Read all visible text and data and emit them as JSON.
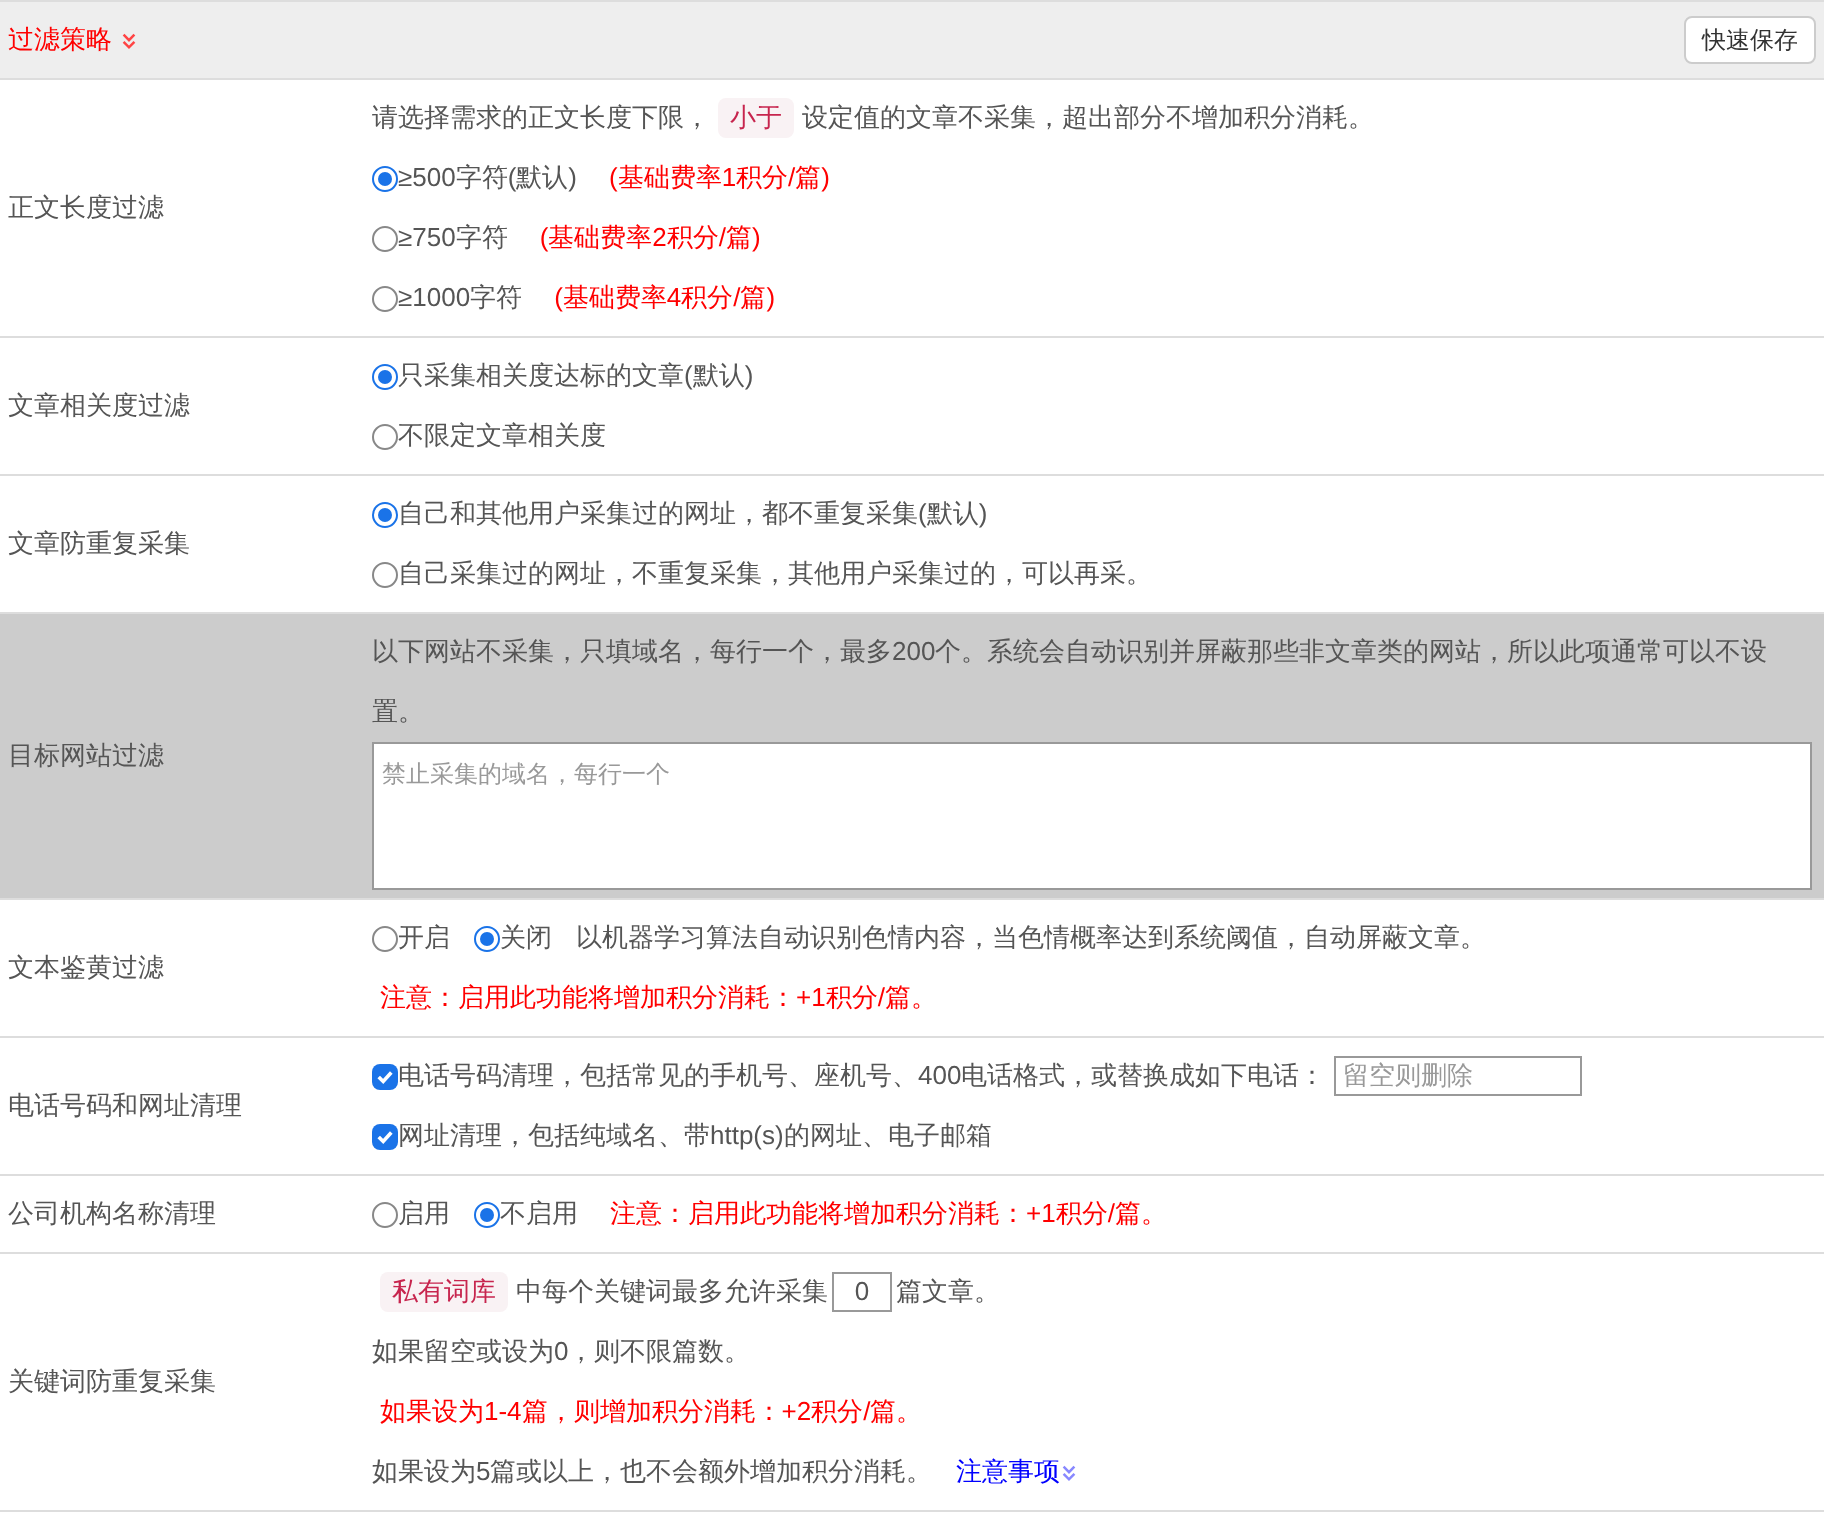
{
  "header": {
    "title": "过滤策略",
    "save_button": "快速保存"
  },
  "sections": [
    {
      "label": "正文长度过滤",
      "highlighted": false,
      "lines": [
        [
          {
            "kind": "text",
            "text": "请选择需求的正文长度下限，"
          },
          {
            "kind": "tag",
            "text": "小于"
          },
          {
            "kind": "text",
            "text": "设定值的文章不采集，超出部分不增加积分消耗。"
          }
        ],
        [
          {
            "kind": "radio",
            "text": "≥500字符(默认)",
            "selected": true
          },
          {
            "kind": "note",
            "text": "(基础费率1积分/篇)"
          }
        ],
        [
          {
            "kind": "radio",
            "text": "≥750字符",
            "selected": false
          },
          {
            "kind": "note",
            "text": "(基础费率2积分/篇)"
          }
        ],
        [
          {
            "kind": "radio",
            "text": "≥1000字符",
            "selected": false
          },
          {
            "kind": "note",
            "text": "(基础费率4积分/篇)"
          }
        ]
      ]
    },
    {
      "label": "文章相关度过滤",
      "highlighted": false,
      "lines": [
        [
          {
            "kind": "radio",
            "text": "只采集相关度达标的文章(默认)",
            "selected": true
          }
        ],
        [
          {
            "kind": "radio",
            "text": "不限定文章相关度",
            "selected": false
          }
        ]
      ]
    },
    {
      "label": "文章防重复采集",
      "highlighted": false,
      "lines": [
        [
          {
            "kind": "radio",
            "text": "自己和其他用户采集过的网址，都不重复采集(默认)",
            "selected": true
          }
        ],
        [
          {
            "kind": "radio",
            "text": "自己采集过的网址，不重复采集，其他用户采集过的，可以再采。",
            "selected": false
          }
        ]
      ]
    },
    {
      "label": "目标网站过滤",
      "highlighted": true,
      "lines": [
        [
          {
            "kind": "text",
            "text": "以下网站不采集，只填域名，每行一个，最多200个。系统会自动识别并屏蔽那些非文章类的网站，所以此项通常可以不设置。"
          }
        ],
        [
          {
            "kind": "textarea",
            "placeholder": "禁止采集的域名，每行一个"
          }
        ]
      ]
    },
    {
      "label": "文本鉴黄过滤",
      "highlighted": false,
      "lines": [
        [
          {
            "kind": "radio",
            "text": "开启",
            "selected": false
          },
          {
            "kind": "radio",
            "text": "关闭",
            "selected": true
          },
          {
            "kind": "text",
            "text": "以机器学习算法自动识别色情内容，当色情概率达到系统阈值，自动屏蔽文章。"
          }
        ],
        [
          {
            "kind": "note",
            "text": "注意：启用此功能将增加积分消耗：+1积分/篇。"
          }
        ]
      ]
    },
    {
      "label": "电话号码和网址清理",
      "highlighted": false,
      "lines": [
        [
          {
            "kind": "checkbox",
            "text": "电话号码清理，包括常见的手机号、座机号、400电话格式，或替换成如下电话：",
            "checked": true
          },
          {
            "kind": "input",
            "placeholder": "留空则删除"
          }
        ],
        [
          {
            "kind": "checkbox",
            "text": "网址清理，包括纯域名、带http(s)的网址、电子邮箱",
            "checked": true
          }
        ]
      ]
    },
    {
      "label": "公司机构名称清理",
      "highlighted": false,
      "lines": [
        [
          {
            "kind": "radio",
            "text": "启用",
            "selected": false
          },
          {
            "kind": "radio",
            "text": "不启用",
            "selected": true
          },
          {
            "kind": "note",
            "text": "注意：启用此功能将增加积分消耗：+1积分/篇。"
          }
        ]
      ]
    },
    {
      "label": "关键词防重复采集",
      "highlighted": false,
      "lines": [
        [
          {
            "kind": "tag",
            "text": "私有词库"
          },
          {
            "kind": "text",
            "text": "中每个关键词最多允许采集"
          },
          {
            "kind": "input",
            "value": "0"
          },
          {
            "kind": "text",
            "text": "篇文章。"
          }
        ],
        [
          {
            "kind": "text",
            "text": "如果留空或设为0，则不限篇数。"
          }
        ],
        [
          {
            "kind": "note",
            "text": "如果设为1-4篇，则增加积分消耗：+2积分/篇。"
          }
        ],
        [
          {
            "kind": "text",
            "text": "如果设为5篇或以上，也不会额外增加积分消耗。"
          },
          {
            "kind": "link",
            "text": "注意事项"
          }
        ]
      ]
    }
  ]
}
